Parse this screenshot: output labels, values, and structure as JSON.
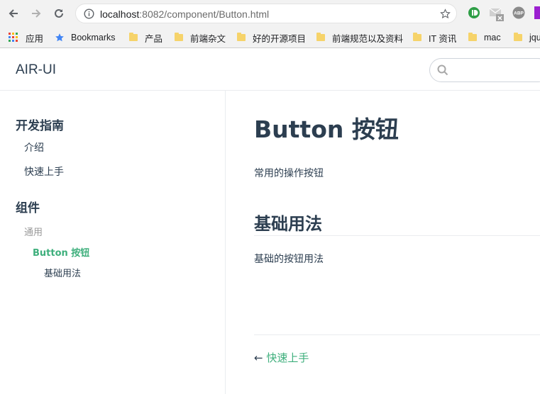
{
  "browser": {
    "url_host": "localhost",
    "url_rest": ":8082/component/Button.html",
    "bookmarks": [
      {
        "label": "应用",
        "icon": "apps-grid-icon"
      },
      {
        "label": "Bookmarks",
        "icon": "star-icon"
      },
      {
        "label": "产品",
        "icon": "folder-icon"
      },
      {
        "label": "前端杂文",
        "icon": "folder-icon"
      },
      {
        "label": "好的开源项目",
        "icon": "folder-icon"
      },
      {
        "label": "前端规范以及资料",
        "icon": "folder-icon"
      },
      {
        "label": "IT 资讯",
        "icon": "folder-icon"
      },
      {
        "label": "mac",
        "icon": "folder-icon"
      },
      {
        "label": "jqu",
        "icon": "folder-icon"
      }
    ],
    "extensions": [
      {
        "name": "green-extension-icon",
        "color": "#2e9e46"
      },
      {
        "name": "mail-extension-icon",
        "color": "#9e9e9e"
      },
      {
        "name": "abp-extension-icon",
        "color": "#8a8a8a",
        "label": "ABP"
      },
      {
        "name": "purple-extension-icon",
        "color": "#9b1fd0"
      }
    ]
  },
  "site": {
    "logo": "AIR-UI",
    "search_placeholder": ""
  },
  "sidebar": {
    "groups": [
      {
        "title": "开发指南",
        "items": [
          "介绍",
          "快速上手"
        ]
      },
      {
        "title": "组件",
        "items": [
          "通用"
        ]
      }
    ],
    "active_item": "Button 按钮",
    "sub_item": "基础用法"
  },
  "content": {
    "title": "Button 按钮",
    "description": "常用的操作按钮",
    "section_title": "基础用法",
    "section_text": "基础的按钮用法",
    "prev_arrow": "←",
    "prev_link": "快速上手"
  },
  "colors": {
    "accent": "#3eaf7c",
    "text": "#2c3e50",
    "muted": "#999999"
  }
}
